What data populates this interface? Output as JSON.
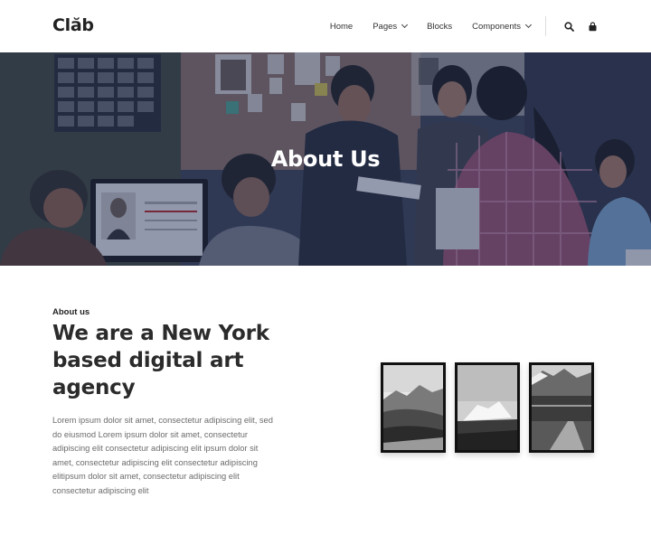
{
  "brand": {
    "logo": "Clăb"
  },
  "nav": {
    "items": [
      {
        "label": "Home",
        "dropdown": false
      },
      {
        "label": "Pages",
        "dropdown": true
      },
      {
        "label": "Blocks",
        "dropdown": false
      },
      {
        "label": "Components",
        "dropdown": true
      }
    ],
    "icons": [
      "search-icon",
      "bag-icon"
    ]
  },
  "hero": {
    "title": "About Us"
  },
  "about": {
    "eyebrow": "About us",
    "headline": "We are a New York based digital art agency",
    "body": "Lorem ipsum dolor sit amet, consectetur adipiscing elit, sed do eiusmod Lorem ipsum dolor sit amet, consectetur adipiscing elit consectetur adipiscing elit ipsum dolor sit amet, consectetur adipiscing elit consectetur adipiscing elitipsum dolor sit amet, consectetur adipiscing elit consectetur adipiscing elit"
  },
  "colors": {
    "hero_overlay": "#26325c",
    "text_dark": "#2b2b2b",
    "text_muted": "#6b6b6b"
  }
}
